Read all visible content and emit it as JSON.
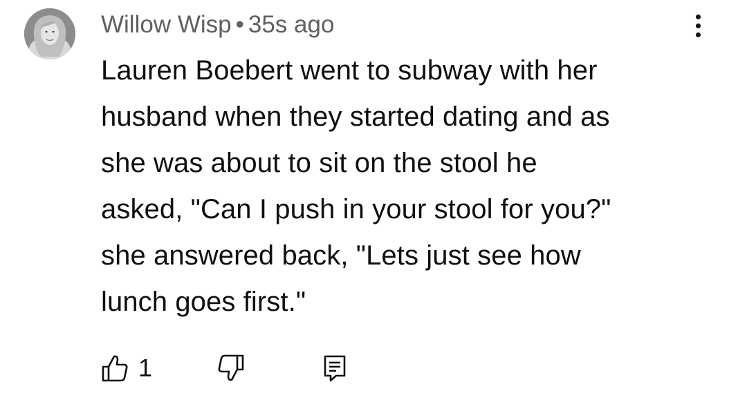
{
  "comment": {
    "author": "Willow Wisp",
    "separator": "•",
    "time": "35s ago",
    "text": "Lauren Boebert went to subway with her\nhusband when they started dating and as\nshe was about to sit on the stool he\nasked, \"Can I push in your stool for you?\"\nshe answered back, \"Lets just see how\nlunch goes first.\"",
    "likes": "1"
  },
  "icons": {
    "like": "thumbs-up-icon",
    "dislike": "thumbs-down-icon",
    "reply": "comment-icon",
    "menu": "more-vertical-icon"
  }
}
